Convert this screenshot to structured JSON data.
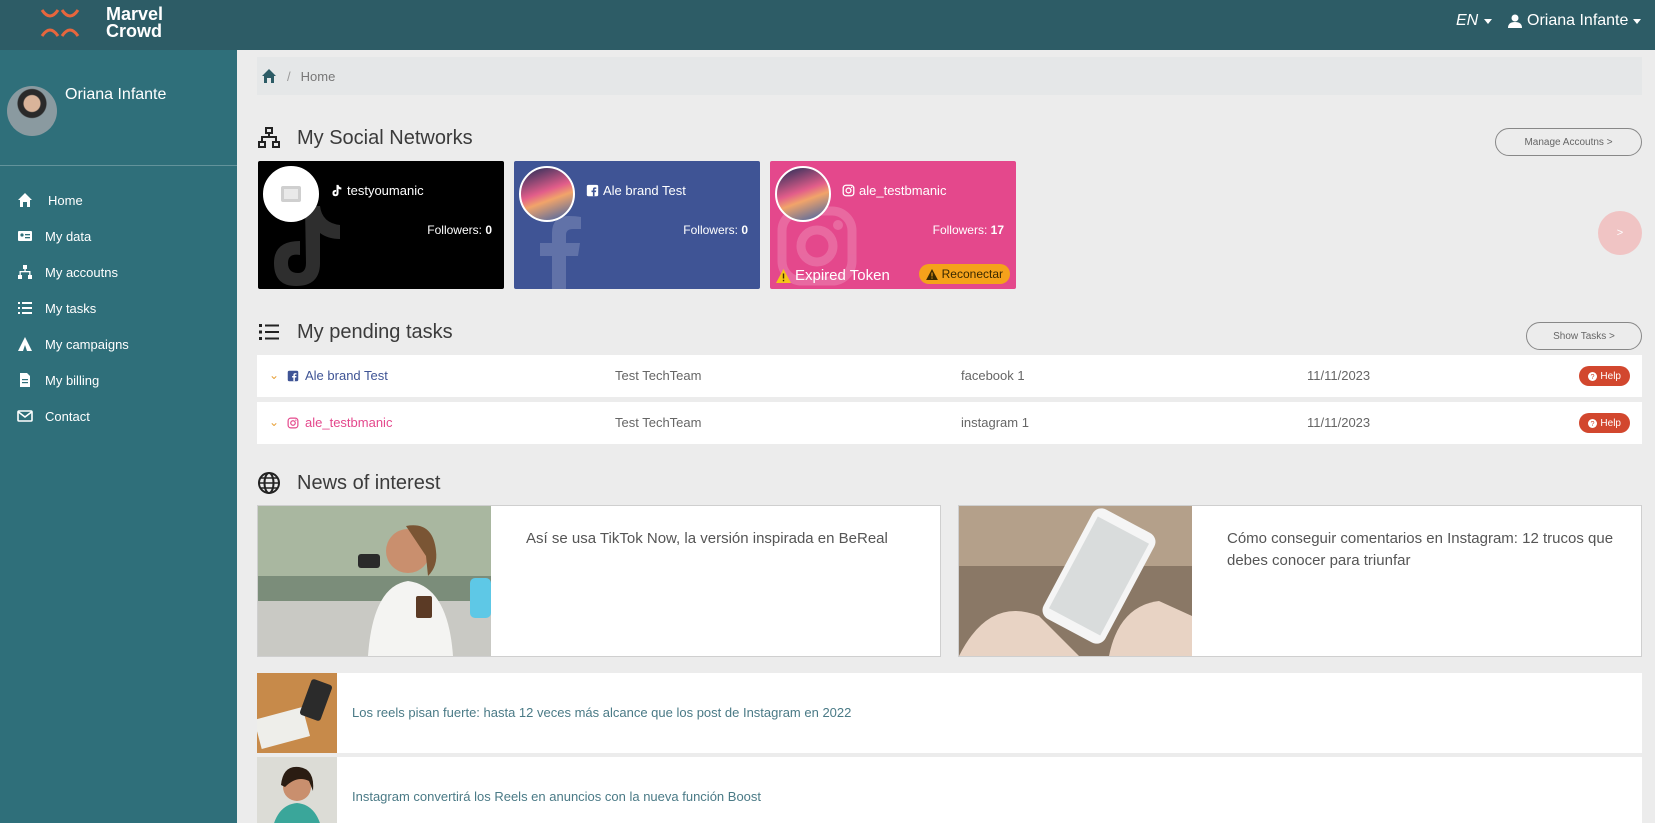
{
  "app": {
    "logo_line1": "Marvel",
    "logo_line2": "Crowd",
    "language": "EN",
    "user_name": "Oriana Infante"
  },
  "colors": {
    "topbar": "#2d5c66",
    "sidebar": "#2f6f7a",
    "tiktok": "#000000",
    "facebook": "#3f5495",
    "instagram": "#e4488c",
    "help": "#d2472e",
    "reconnect": "#f5a21b"
  },
  "sidebar": {
    "profile_name": "Oriana Infante",
    "items": [
      {
        "label": "Home",
        "icon": "home-icon"
      },
      {
        "label": "My data",
        "icon": "id-card-icon"
      },
      {
        "label": "My accoutns",
        "icon": "sitemap-icon"
      },
      {
        "label": "My tasks",
        "icon": "list-icon"
      },
      {
        "label": "My campaigns",
        "icon": "campground-icon"
      },
      {
        "label": "My billing",
        "icon": "file-icon"
      },
      {
        "label": "Contact",
        "icon": "envelope-icon"
      }
    ]
  },
  "breadcrumb": {
    "current": "Home",
    "separator": "/"
  },
  "social": {
    "title": "My Social Networks",
    "manage_label": "Manage Accoutns >",
    "next_label": ">",
    "cards": [
      {
        "name": "testyoumanic",
        "network": "tiktok",
        "followers_label": "Followers:",
        "followers": "0"
      },
      {
        "name": "Ale brand Test",
        "network": "facebook",
        "followers_label": "Followers:",
        "followers": "0"
      },
      {
        "name": "ale_testbmanic",
        "network": "instagram",
        "followers_label": "Followers:",
        "followers": "17",
        "status": "Expired Token",
        "action": "Reconectar"
      }
    ]
  },
  "tasks": {
    "title": "My pending tasks",
    "show_label": "Show Tasks >",
    "help_label": "Help",
    "rows": [
      {
        "account": "Ale brand Test",
        "network": "facebook",
        "team": "Test TechTeam",
        "task": "facebook 1",
        "date": "11/11/2023"
      },
      {
        "account": "ale_testbmanic",
        "network": "instagram",
        "team": "Test TechTeam",
        "task": "instagram 1",
        "date": "11/11/2023"
      }
    ]
  },
  "news": {
    "title": "News of interest",
    "featured": [
      {
        "title": "Así se usa TikTok Now, la versión inspirada en BeReal"
      },
      {
        "title": "Cómo conseguir comentarios en Instagram: 12 trucos que debes conocer para triunfar"
      }
    ],
    "list": [
      {
        "title": "Los reels pisan fuerte: hasta 12 veces más alcance que los post de Instagram en 2022"
      },
      {
        "title": "Instagram convertirá los Reels en anuncios con la nueva función Boost"
      }
    ]
  }
}
